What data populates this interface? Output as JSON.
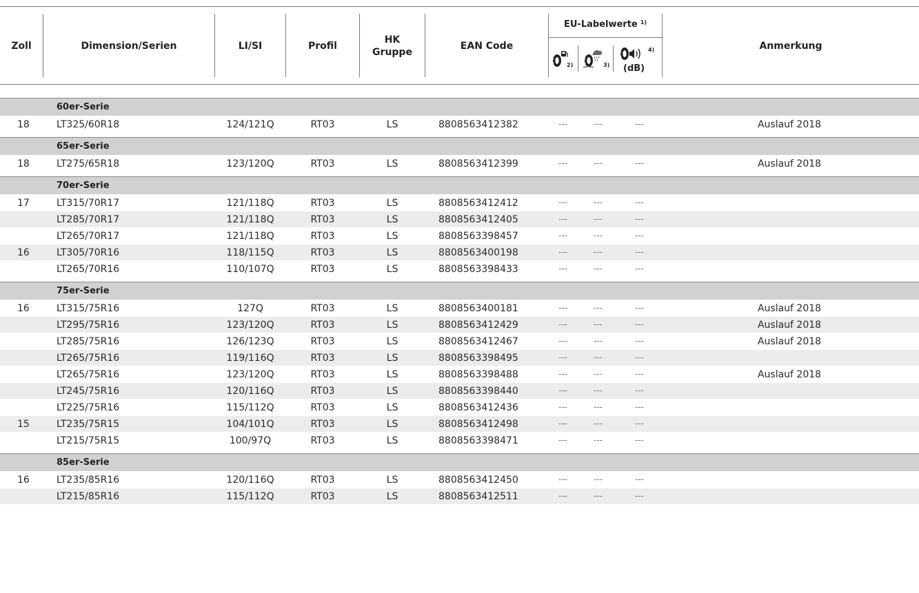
{
  "header": {
    "zoll": "Zoll",
    "dimension": "Dimension/Serien",
    "li_si": "LI/SI",
    "profil": "Profil",
    "hk_line1": "HK",
    "hk_line2": "Gruppe",
    "ean": "EAN Code",
    "eu_title": "EU-Labelwerte",
    "eu_title_note": "1)",
    "eu_icons": [
      {
        "icon": "fuel-efficiency-tire-icon",
        "note": "2)"
      },
      {
        "icon": "wet-grip-tire-icon",
        "note": "3)"
      },
      {
        "icon": "noise-tire-icon",
        "note": "4)",
        "unit": "(dB)"
      }
    ],
    "anmerkung": "Anmerkung"
  },
  "groups": [
    {
      "title": "60er-Serie",
      "rows": [
        {
          "zoll": "18",
          "dimension": "LT325/60R18",
          "li_si": "124/121Q",
          "profil": "RT03",
          "hk": "LS",
          "ean": "8808563412382",
          "eu1": "---",
          "eu2": "---",
          "eu3": "---",
          "anmerkung": "Auslauf 2018"
        }
      ]
    },
    {
      "title": "65er-Serie",
      "rows": [
        {
          "zoll": "18",
          "dimension": "LT275/65R18",
          "li_si": "123/120Q",
          "profil": "RT03",
          "hk": "LS",
          "ean": "8808563412399",
          "eu1": "---",
          "eu2": "---",
          "eu3": "---",
          "anmerkung": "Auslauf 2018"
        }
      ]
    },
    {
      "title": "70er-Serie",
      "rows": [
        {
          "zoll": "17",
          "dimension": "LT315/70R17",
          "li_si": "121/118Q",
          "profil": "RT03",
          "hk": "LS",
          "ean": "8808563412412",
          "eu1": "---",
          "eu2": "---",
          "eu3": "---",
          "anmerkung": ""
        },
        {
          "zoll": "",
          "dimension": "LT285/70R17",
          "li_si": "121/118Q",
          "profil": "RT03",
          "hk": "LS",
          "ean": "8808563412405",
          "eu1": "---",
          "eu2": "---",
          "eu3": "---",
          "anmerkung": ""
        },
        {
          "zoll": "",
          "dimension": "LT265/70R17",
          "li_si": "121/118Q",
          "profil": "RT03",
          "hk": "LS",
          "ean": "8808563398457",
          "eu1": "---",
          "eu2": "---",
          "eu3": "---",
          "anmerkung": ""
        },
        {
          "zoll": "16",
          "dimension": "LT305/70R16",
          "li_si": "118/115Q",
          "profil": "RT03",
          "hk": "LS",
          "ean": "8808563400198",
          "eu1": "---",
          "eu2": "---",
          "eu3": "---",
          "anmerkung": ""
        },
        {
          "zoll": "",
          "dimension": "LT265/70R16",
          "li_si": "110/107Q",
          "profil": "RT03",
          "hk": "LS",
          "ean": "8808563398433",
          "eu1": "---",
          "eu2": "---",
          "eu3": "---",
          "anmerkung": ""
        }
      ]
    },
    {
      "title": "75er-Serie",
      "rows": [
        {
          "zoll": "16",
          "dimension": "LT315/75R16",
          "li_si": "127Q",
          "profil": "RT03",
          "hk": "LS",
          "ean": "8808563400181",
          "eu1": "---",
          "eu2": "---",
          "eu3": "---",
          "anmerkung": "Auslauf 2018"
        },
        {
          "zoll": "",
          "dimension": "LT295/75R16",
          "li_si": "123/120Q",
          "profil": "RT03",
          "hk": "LS",
          "ean": "8808563412429",
          "eu1": "---",
          "eu2": "---",
          "eu3": "---",
          "anmerkung": "Auslauf 2018"
        },
        {
          "zoll": "",
          "dimension": "LT285/75R16",
          "li_si": "126/123Q",
          "profil": "RT03",
          "hk": "LS",
          "ean": "8808563412467",
          "eu1": "---",
          "eu2": "---",
          "eu3": "---",
          "anmerkung": "Auslauf 2018"
        },
        {
          "zoll": "",
          "dimension": "LT265/75R16",
          "li_si": "119/116Q",
          "profil": "RT03",
          "hk": "LS",
          "ean": "8808563398495",
          "eu1": "---",
          "eu2": "---",
          "eu3": "---",
          "anmerkung": ""
        },
        {
          "zoll": "",
          "dimension": "LT265/75R16",
          "li_si": "123/120Q",
          "profil": "RT03",
          "hk": "LS",
          "ean": "8808563398488",
          "eu1": "---",
          "eu2": "---",
          "eu3": "---",
          "anmerkung": "Auslauf 2018"
        },
        {
          "zoll": "",
          "dimension": "LT245/75R16",
          "li_si": "120/116Q",
          "profil": "RT03",
          "hk": "LS",
          "ean": "8808563398440",
          "eu1": "---",
          "eu2": "---",
          "eu3": "---",
          "anmerkung": ""
        },
        {
          "zoll": "",
          "dimension": "LT225/75R16",
          "li_si": "115/112Q",
          "profil": "RT03",
          "hk": "LS",
          "ean": "8808563412436",
          "eu1": "---",
          "eu2": "---",
          "eu3": "---",
          "anmerkung": ""
        },
        {
          "zoll": "15",
          "dimension": "LT235/75R15",
          "li_si": "104/101Q",
          "profil": "RT03",
          "hk": "LS",
          "ean": "8808563412498",
          "eu1": "---",
          "eu2": "---",
          "eu3": "---",
          "anmerkung": ""
        },
        {
          "zoll": "",
          "dimension": "LT215/75R15",
          "li_si": "100/97Q",
          "profil": "RT03",
          "hk": "LS",
          "ean": "8808563398471",
          "eu1": "---",
          "eu2": "---",
          "eu3": "---",
          "anmerkung": ""
        }
      ]
    },
    {
      "title": "85er-Serie",
      "rows": [
        {
          "zoll": "16",
          "dimension": "LT235/85R16",
          "li_si": "120/116Q",
          "profil": "RT03",
          "hk": "LS",
          "ean": "8808563412450",
          "eu1": "---",
          "eu2": "---",
          "eu3": "---",
          "anmerkung": ""
        },
        {
          "zoll": "",
          "dimension": "LT215/85R16",
          "li_si": "115/112Q",
          "profil": "RT03",
          "hk": "LS",
          "ean": "8808563412511",
          "eu1": "---",
          "eu2": "---",
          "eu3": "---",
          "anmerkung": ""
        }
      ]
    }
  ],
  "colors": {
    "series_band": "#d1d1d1",
    "row_shade": "#ececec",
    "rule": "#7a7a7a"
  }
}
